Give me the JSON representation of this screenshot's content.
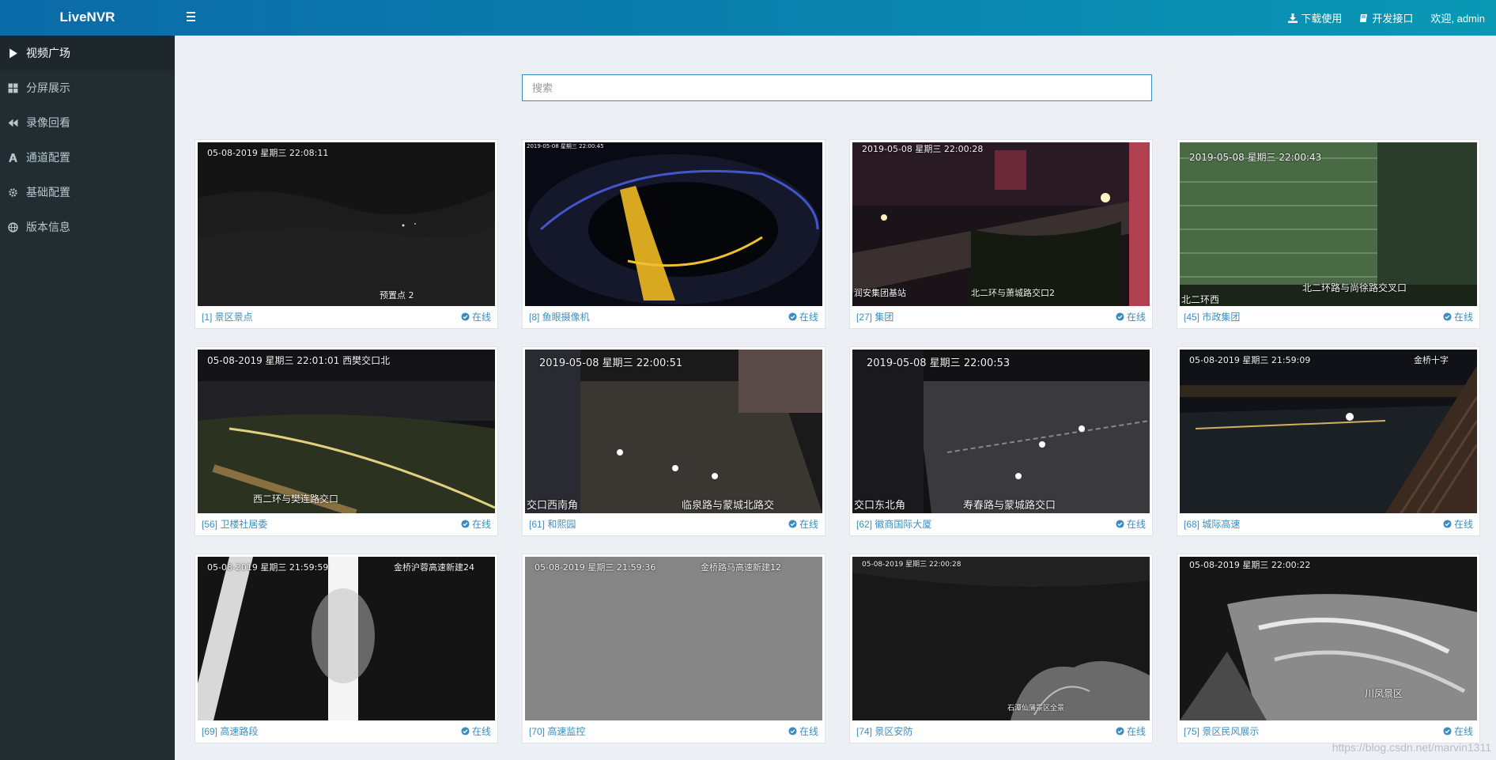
{
  "app": {
    "title": "LiveNVR"
  },
  "header": {
    "download_label": "下载使用",
    "api_label": "开发接口",
    "welcome_label": "欢迎, admin"
  },
  "sidebar": {
    "items": [
      {
        "label": "视频广场",
        "icon": "play-icon"
      },
      {
        "label": "分屏展示",
        "icon": "grid-icon"
      },
      {
        "label": "录像回看",
        "icon": "backward-icon"
      },
      {
        "label": "通道配置",
        "icon": "channel-icon"
      },
      {
        "label": "基础配置",
        "icon": "gear-icon"
      },
      {
        "label": "版本信息",
        "icon": "globe-icon"
      }
    ]
  },
  "search": {
    "placeholder": "搜索"
  },
  "channels": [
    {
      "label": "[1] 景区景点",
      "status": "在线",
      "osd": [
        "05-08-2019 星期三 22:08:11",
        "预置点 2"
      ]
    },
    {
      "label": "[8] 鱼眼摄像机",
      "status": "在线",
      "osd": [
        "2019-05-08 星期三 22:00:45"
      ]
    },
    {
      "label": "[27] 集团",
      "status": "在线",
      "osd": [
        "2019-05-08 星期三 22:00:28",
        "润安集团基站",
        "北二环与萧城路交口2"
      ]
    },
    {
      "label": "[45] 市政集团",
      "status": "在线",
      "osd": [
        "2019-05-08 星期三 22:00:43",
        "北二环西",
        "北二环路与尚徐路交叉口"
      ]
    },
    {
      "label": "[56] 卫楼社居委",
      "status": "在线",
      "osd": [
        "05-08-2019 星期三 22:01:01 西樊交口北",
        "西二环与樊连路交口"
      ]
    },
    {
      "label": "[61] 和熙园",
      "status": "在线",
      "osd": [
        "2019-05-08 星期三 22:00:51",
        "交口西南角",
        "临泉路与蒙城北路交"
      ]
    },
    {
      "label": "[62] 徽商国际大厦",
      "status": "在线",
      "osd": [
        "2019-05-08 星期三 22:00:53",
        "交口东北角",
        "寿春路与蒙城路交口"
      ]
    },
    {
      "label": "[68] 城际高速",
      "status": "在线",
      "osd": [
        "05-08-2019 星期三 21:59:09",
        "金桥十字"
      ]
    },
    {
      "label": "[69] 高速路段",
      "status": "在线",
      "osd": [
        "05-08-2019 星期三 21:59:59",
        "金桥沪蓉高速新建24"
      ]
    },
    {
      "label": "[70] 高速监控",
      "status": "在线",
      "osd": [
        "05-08-2019 星期三 21:59:36",
        "金桥路马高速新建12"
      ]
    },
    {
      "label": "[74] 景区安防",
      "status": "在线",
      "osd": [
        "05-08-2019 星期三 22:00:28",
        "石潭仙蒲景区全景"
      ]
    },
    {
      "label": "[75] 景区民风展示",
      "status": "在线",
      "osd": [
        "05-08-2019 星期三 22:00:22",
        "川凤景区"
      ]
    }
  ],
  "watermark": "https://blog.csdn.net/marvin1311",
  "colors": {
    "accent": "#3c8dbc",
    "sidebar_bg": "#222d32",
    "topbar_start": "#0b6aa8",
    "topbar_end": "#0a98b5"
  }
}
